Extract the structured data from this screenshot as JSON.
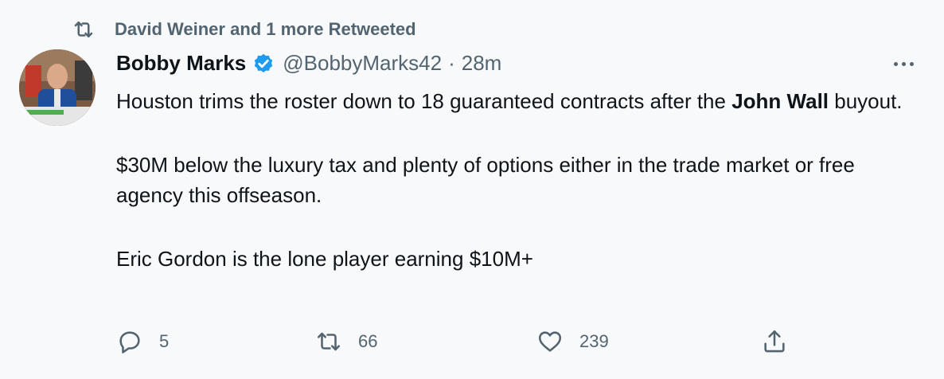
{
  "retweet_context": {
    "text": "David Weiner and 1 more Retweeted",
    "icon": "retweet-icon"
  },
  "author": {
    "name": "Bobby Marks",
    "verified_icon": "verified-badge-icon",
    "handle": "@BobbyMarks42",
    "separator": "·",
    "time": "28m"
  },
  "tweet": {
    "p1_a": "Houston trims the roster down to 18 guaranteed contracts after the ",
    "p1_bold": "John Wall",
    "p1_b": " buyout.",
    "p2": "$30M below the luxury tax and plenty of options either in the trade market or free agency this offseason.",
    "p3": "Eric Gordon is the lone player earning $10M+"
  },
  "actions": {
    "reply": {
      "icon": "reply-icon",
      "count": "5"
    },
    "retweet": {
      "icon": "retweet-icon",
      "count": "66"
    },
    "like": {
      "icon": "heart-icon",
      "count": "239"
    },
    "share": {
      "icon": "share-icon"
    }
  },
  "more_icon": "more-horizontal-icon",
  "colors": {
    "text": "#0f1419",
    "secondary": "#536471",
    "verified": "#1d9bf0",
    "background": "#f7f9fa"
  }
}
